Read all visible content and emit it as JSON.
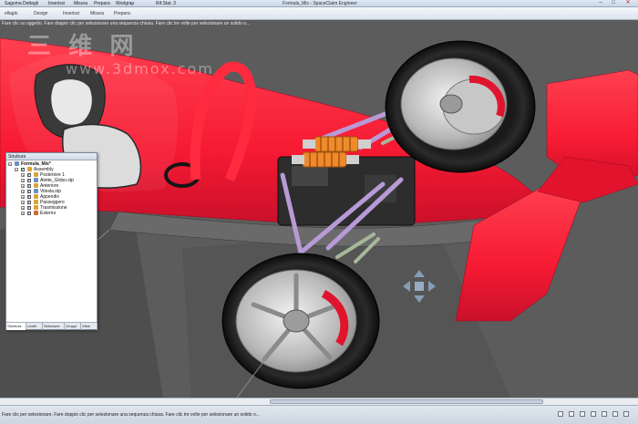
{
  "window": {
    "title": "Formula_Mix - SpaceClaim Engineer",
    "tabs": [
      "Sagoma",
      "Dettagli",
      "Inserisci",
      "Misura",
      "Prepara",
      "Wodgrap",
      "Rif.Stat. 3"
    ],
    "min_glyph": "–",
    "max_glyph": "□",
    "close_glyph": "✕"
  },
  "ribbon": {
    "tabs": [
      "ellagio",
      "Design",
      "Inserisci",
      "Misura",
      "Prepara"
    ]
  },
  "hint": "Fare clic su oggetto. Fare doppio clic per selezionare una sequenza chiusa. Fare clic tre volte per selezionare un solido o...",
  "watermark": {
    "main": "三 维 网",
    "url": "www.3dmox.com"
  },
  "structure": {
    "title": "Struttura",
    "root": "Formula_Mix*",
    "assembly": "Assembly",
    "items": [
      "Posteriore 1",
      "Alette_Globo.stp",
      "Anteriore",
      "Vitesla.stp",
      "Appendix",
      "Passeggero",
      "Trasmissione",
      "Esterno"
    ],
    "tabs": [
      "Struttura",
      "Livelli",
      "Selezione",
      "Gruppi",
      "Viste"
    ]
  },
  "status": {
    "text": "Fare clic per selezionare. Fare doppio clic per selezionare una sequenza chiusa. Fare clic tre volte per selezionare un solido o..."
  },
  "colors": {
    "body_red": "#ff1f3a",
    "viewport_bg": "#5c5c5c",
    "spring": "#f08a2a",
    "arm": "#b79ad6"
  }
}
